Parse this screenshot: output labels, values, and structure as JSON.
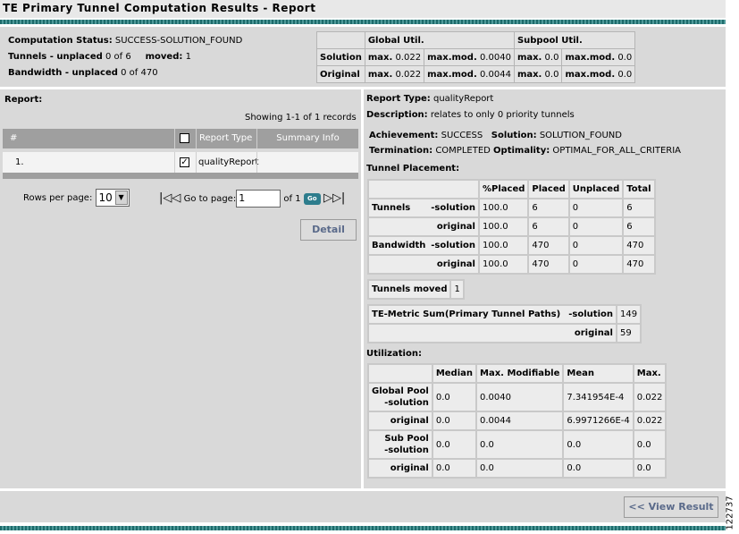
{
  "title": "TE Primary Tunnel Computation Results - Report",
  "side_id": "122737",
  "status": {
    "computation_label": "Computation Status:",
    "computation_value": "SUCCESS-SOLUTION_FOUND",
    "tunnels_label": "Tunnels - unplaced",
    "tunnels_value": "0 of 6",
    "moved_label": "moved:",
    "moved_value": "1",
    "bandwidth_label": "Bandwidth - unplaced",
    "bandwidth_value": "0 of 470"
  },
  "util_table": {
    "global_header": "Global Util.",
    "subpool_header": "Subpool Util.",
    "rows": [
      {
        "label": "Solution",
        "g_max_l": "max.",
        "g_max_v": "0.022",
        "g_mod_l": "max.mod.",
        "g_mod_v": "0.0040",
        "s_max_l": "max.",
        "s_max_v": "0.0",
        "s_mod_l": "max.mod.",
        "s_mod_v": "0.0"
      },
      {
        "label": "Original",
        "g_max_l": "max.",
        "g_max_v": "0.022",
        "g_mod_l": "max.mod.",
        "g_mod_v": "0.0044",
        "s_max_l": "max.",
        "s_max_v": "0.0",
        "s_mod_l": "max.mod.",
        "s_mod_v": "0.0"
      }
    ]
  },
  "left": {
    "report_label": "Report:",
    "showing": "Showing 1-1 of 1 records",
    "columns": {
      "num": "#",
      "type": "Report Type",
      "summary": "Summary Info"
    },
    "row": {
      "num": "1.",
      "type": "qualityReport",
      "summary": ""
    },
    "rows_per_page_label": "Rows per page:",
    "rows_per_page_value": "10",
    "goto_label": "Go to page:",
    "goto_value": "1",
    "of_label": "of 1",
    "go_label": "Go",
    "detail_button": "Detail"
  },
  "right": {
    "report_type_label": "Report Type:",
    "report_type_value": "qualityReport",
    "description_label": "Description:",
    "description_value": "relates to only 0 priority tunnels",
    "achievement_label": "Achievement:",
    "achievement_value": "SUCCESS",
    "solution_label": "Solution:",
    "solution_value": "SOLUTION_FOUND",
    "termination_label": "Termination:",
    "termination_value": "COMPLETED",
    "optimality_label": "Optimality:",
    "optimality_value": "OPTIMAL_FOR_ALL_CRITERIA",
    "placement_label": "Tunnel Placement:",
    "placement": {
      "headers": [
        "%Placed",
        "Placed",
        "Unplaced",
        "Total"
      ],
      "rows": [
        {
          "l1": "Tunnels",
          "l2": "-solution",
          "v": [
            "100.0",
            "6",
            "0",
            "6"
          ]
        },
        {
          "l1": "",
          "l2": "original",
          "v": [
            "100.0",
            "6",
            "0",
            "6"
          ]
        },
        {
          "l1": "Bandwidth",
          "l2": "-solution",
          "v": [
            "100.0",
            "470",
            "0",
            "470"
          ]
        },
        {
          "l1": "",
          "l2": "original",
          "v": [
            "100.0",
            "470",
            "0",
            "470"
          ]
        }
      ]
    },
    "tunnels_moved_label": "Tunnels moved",
    "tunnels_moved_value": "1",
    "te_metric_label": "TE-Metric Sum(Primary Tunnel Paths)",
    "te_solution_label": "-solution",
    "te_solution_value": "149",
    "te_original_label": "original",
    "te_original_value": "59",
    "utilization_label": "Utilization:",
    "utilization": {
      "headers": [
        "Median",
        "Max. Modifiable",
        "Mean",
        "Max."
      ],
      "rows": [
        {
          "l1": "Global Pool",
          "l2": "-solution",
          "v": [
            "0.0",
            "0.0040",
            "7.341954E-4",
            "0.022"
          ]
        },
        {
          "l1": "",
          "l2": "original",
          "v": [
            "0.0",
            "0.0044",
            "6.9971266E-4",
            "0.022"
          ]
        },
        {
          "l1": "Sub Pool",
          "l2": "-solution",
          "v": [
            "0.0",
            "0.0",
            "0.0",
            "0.0"
          ]
        },
        {
          "l1": "",
          "l2": "original",
          "v": [
            "0.0",
            "0.0",
            "0.0",
            "0.0"
          ]
        }
      ]
    }
  },
  "footer": {
    "view_result": "<< View Result"
  }
}
